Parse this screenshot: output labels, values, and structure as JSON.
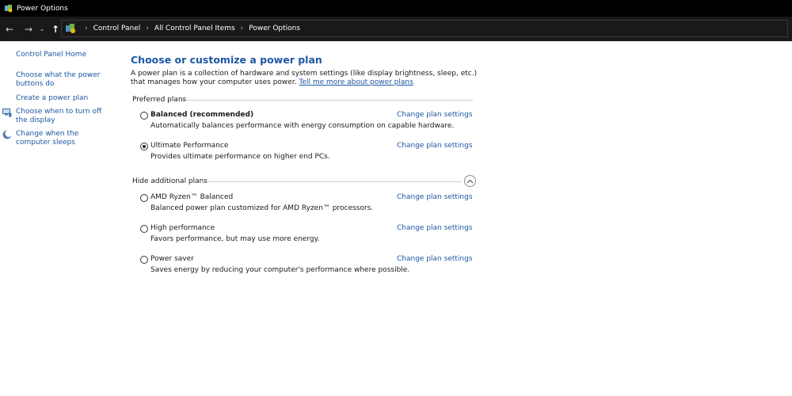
{
  "window": {
    "title": "Power Options"
  },
  "address_bar": {
    "breadcrumbs": [
      "Control Panel",
      "All Control Panel Items",
      "Power Options"
    ],
    "back_icon": "arrow-left-icon",
    "forward_icon": "arrow-right-icon",
    "recent_icon": "chevron-down-icon",
    "up_icon": "arrow-up-icon"
  },
  "sidebar": {
    "home": "Control Panel Home",
    "links": [
      {
        "label": "Choose what the power buttons do"
      },
      {
        "label": "Create a power plan"
      },
      {
        "label": "Choose when to turn off the display",
        "icon": "monitor-shield-icon"
      },
      {
        "label": "Change when the computer sleeps",
        "icon": "moon-icon"
      }
    ]
  },
  "main": {
    "title": "Choose or customize a power plan",
    "intro_text": "A power plan is a collection of hardware and system settings (like display brightness, sleep, etc.) that manages how your computer uses power.",
    "intro_link": "Tell me more about power plans",
    "preferred_header": "Preferred plans",
    "additional_header": "Hide additional plans",
    "change_label": "Change plan settings",
    "preferred_plans": [
      {
        "name": "Balanced (recommended)",
        "desc": "Automatically balances performance with energy consumption on capable hardware.",
        "selected": false,
        "bold": true
      },
      {
        "name": "Ultimate Performance",
        "desc": "Provides ultimate performance on higher end PCs.",
        "selected": true,
        "bold": false
      }
    ],
    "additional_plans": [
      {
        "name": "AMD Ryzen™ Balanced",
        "desc": "Balanced power plan customized for AMD Ryzen™ processors.",
        "selected": false
      },
      {
        "name": "High performance",
        "desc": "Favors performance, but may use more energy.",
        "selected": false
      },
      {
        "name": "Power saver",
        "desc": "Saves energy by reducing your computer's performance where possible.",
        "selected": false
      }
    ]
  },
  "colors": {
    "link": "#1d57a3",
    "titlebar": "#000000",
    "addressbar": "#191919"
  }
}
